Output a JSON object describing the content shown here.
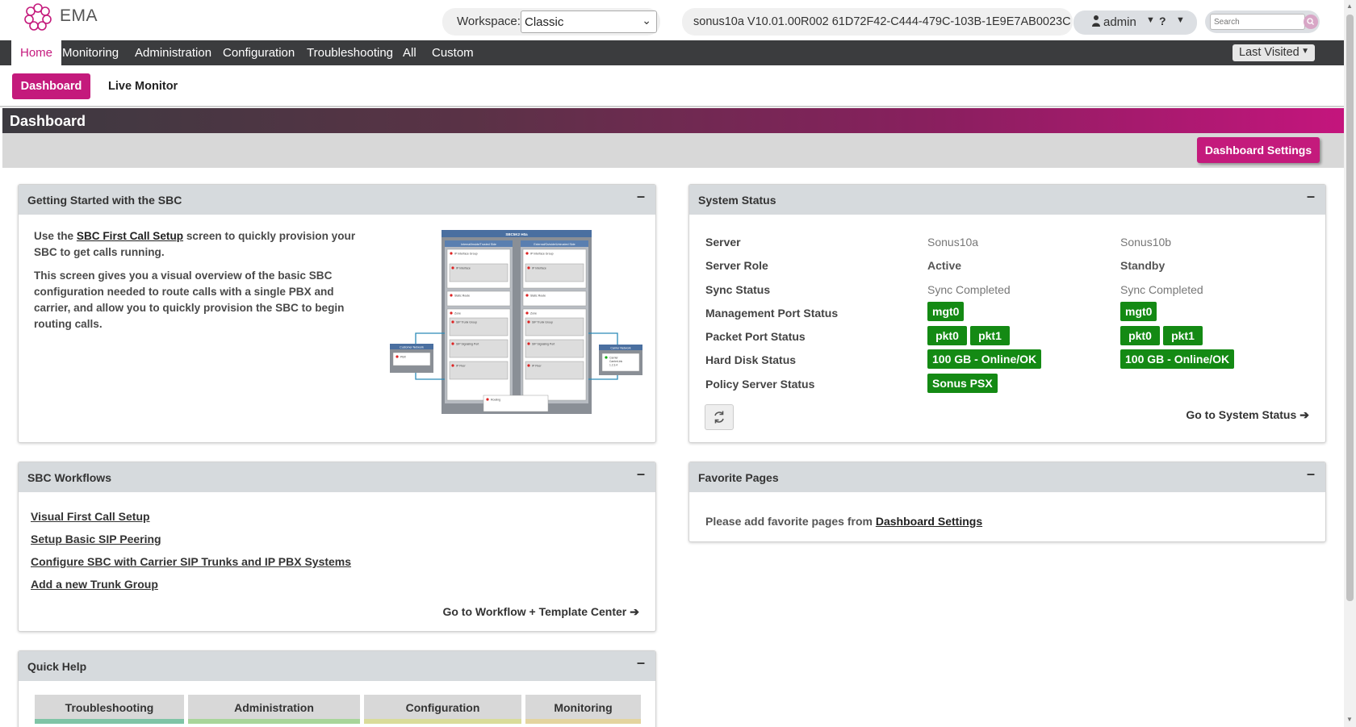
{
  "app": {
    "logo_text": "EMA"
  },
  "header": {
    "workspace_label": "Workspace:",
    "workspace_value": "Classic",
    "version": "sonus10a V10.01.00R002 61D72F42-C444-479C-103B-1E9E7AB0023C",
    "user": "admin",
    "help": "?",
    "search_placeholder": "Search"
  },
  "nav": {
    "items": [
      "Home",
      "Monitoring",
      "Administration",
      "Configuration",
      "Troubleshooting",
      "All",
      "Custom"
    ],
    "active": "Home",
    "last_visited": "Last Visited"
  },
  "subnav": {
    "dashboard": "Dashboard",
    "live_monitor": "Live Monitor"
  },
  "dashboard": {
    "title": "Dashboard",
    "settings_button": "Dashboard Settings"
  },
  "getting_started": {
    "title": "Getting Started with the SBC",
    "p1_pre": "Use the ",
    "p1_link": "SBC First Call Setup",
    "p1_post": " screen to quickly provision your SBC to get calls running.",
    "p2": "This screen gives you a visual overview of the basic SBC configuration needed to route calls with a single PBX and carrier, and allow you to quickly provision the SBC to begin routing calls.",
    "diagram": {
      "title": "SBC5K2 H0a",
      "left_header": "Internal/Inside/Trusted Side",
      "right_header": "External/Outside/Untrusted Side",
      "left_items": [
        "IP Interface Group",
        "IP Interface",
        "Static Route",
        "Zone",
        "SIP Trunk Group",
        "SIP Signaling Port",
        "IP Peer"
      ],
      "right_items": [
        "IP Interface Group",
        "IP Interface",
        "Static Route",
        "Zone",
        "SIP Trunk Group",
        "SIP Signaling Port",
        "IP Peer"
      ],
      "customer_network": "Customer Network",
      "pbx": "PBX",
      "carrier_network": "Carrier Network",
      "carrier": "Carrier",
      "carrier_sub": "CarrierLink",
      "carrier_ip": "1.2.3.4",
      "routing": "Routing"
    }
  },
  "system_status": {
    "title": "System Status",
    "rows": [
      {
        "label": "Server",
        "a": "Sonus10a",
        "b": "Sonus10b",
        "kind": "text"
      },
      {
        "label": "Server Role",
        "a": "Active",
        "b": "Standby",
        "kind": "bold"
      },
      {
        "label": "Sync Status",
        "a": "Sync Completed",
        "b": "Sync Completed",
        "kind": "text"
      },
      {
        "label": "Management Port Status",
        "a": [
          "mgt0"
        ],
        "b": [
          "mgt0"
        ],
        "kind": "badge"
      },
      {
        "label": "Packet Port Status",
        "a": [
          "pkt0",
          "pkt1"
        ],
        "b": [
          "pkt0",
          "pkt1"
        ],
        "kind": "badge"
      },
      {
        "label": "Hard Disk Status",
        "a": [
          "100 GB - Online/OK"
        ],
        "b": [
          "100 GB - Online/OK"
        ],
        "kind": "badge"
      },
      {
        "label": "Policy Server Status",
        "a": [
          "Sonus PSX"
        ],
        "b": [],
        "kind": "badge"
      }
    ],
    "goto": "Go to System Status"
  },
  "workflows": {
    "title": "SBC Workflows",
    "links": [
      "Visual First Call Setup",
      "Setup Basic SIP Peering",
      "Configure SBC with Carrier SIP Trunks and IP PBX Systems",
      "Add a new Trunk Group"
    ],
    "goto": "Go to Workflow + Template Center"
  },
  "favorites": {
    "title": "Favorite Pages",
    "text_pre": "Please add favorite pages from ",
    "text_link": "Dashboard Settings"
  },
  "quick_help": {
    "title": "Quick Help",
    "tabs": [
      "Troubleshooting",
      "Administration",
      "Configuration",
      "Monitoring"
    ],
    "tab_colors": [
      "#7fc4a6",
      "#a8d59a",
      "#d9dc9a",
      "#e3d49f"
    ]
  },
  "colors": {
    "accent": "#c41a7c",
    "status_ok": "#148a14",
    "nav_bg": "#3b3c3e"
  }
}
